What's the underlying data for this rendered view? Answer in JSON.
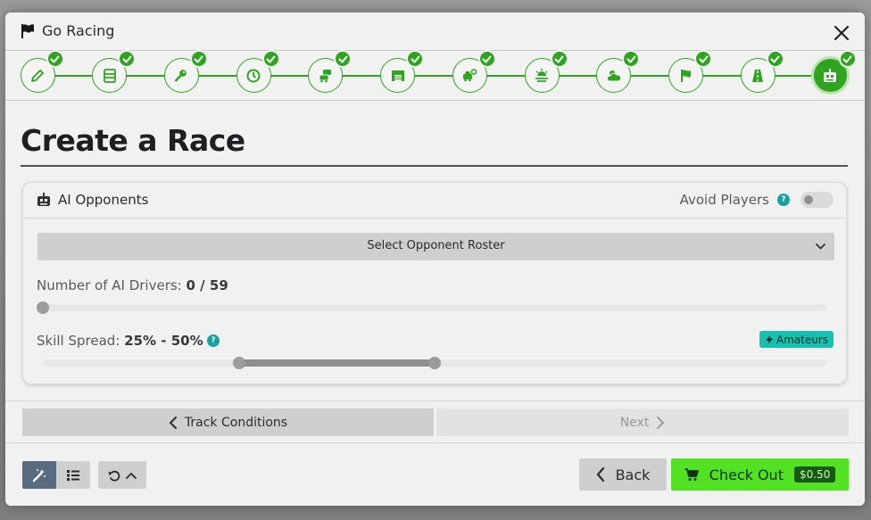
{
  "window": {
    "title": "Go Racing"
  },
  "stepper": {
    "steps": [
      {
        "icon": "pencil-icon",
        "completed": true
      },
      {
        "icon": "server-icon",
        "completed": true
      },
      {
        "icon": "key-icon",
        "completed": true
      },
      {
        "icon": "clock-icon",
        "completed": true
      },
      {
        "icon": "cars-icon",
        "completed": true
      },
      {
        "icon": "garage-icon",
        "completed": true
      },
      {
        "icon": "car-settings-icon",
        "completed": true
      },
      {
        "icon": "track-light-icon",
        "completed": true
      },
      {
        "icon": "weather-icon",
        "completed": true
      },
      {
        "icon": "flag-icon",
        "completed": true
      },
      {
        "icon": "road-icon",
        "completed": true
      },
      {
        "icon": "robot-icon",
        "completed": true,
        "active": true
      }
    ],
    "accent": "#2fa51f"
  },
  "page": {
    "heading": "Create a Race"
  },
  "ai_card": {
    "title": "AI Opponents",
    "avoid_players_label": "Avoid Players",
    "avoid_players_on": false,
    "help_glyph": "?",
    "roster_select_label": "Select Opponent Roster",
    "drivers_label": "Number of AI Drivers:",
    "drivers_value": "0 / 59",
    "drivers_fraction": 0,
    "skill_label": "Skill Spread:",
    "skill_value": "25% - 50%",
    "skill_range": [
      0.25,
      0.5
    ],
    "skill_badge": "Amateurs",
    "badge_color": "#14c2b0"
  },
  "nav": {
    "prev_label": "Track Conditions",
    "next_label": "Next"
  },
  "footer": {
    "back_label": "Back",
    "checkout_label": "Check Out",
    "price": "$0.50",
    "checkout_color": "#53e124"
  }
}
